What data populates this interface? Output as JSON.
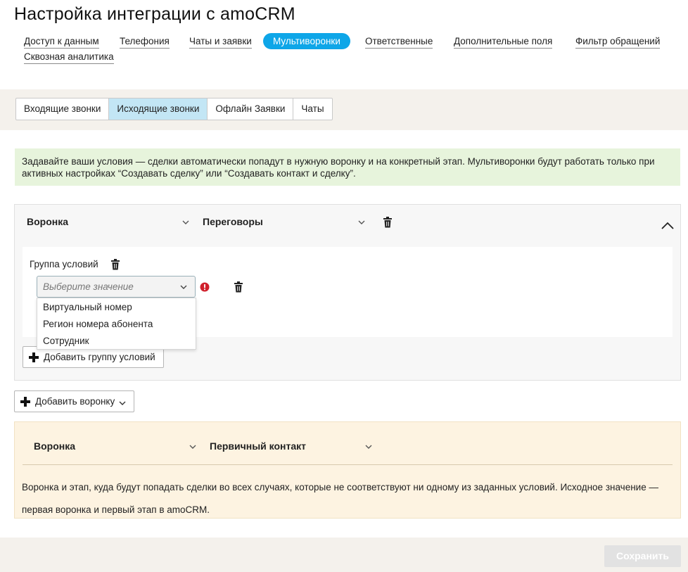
{
  "page_title": "Настройка интеграции с amoCRM",
  "nav": {
    "items": [
      "Доступ к данным",
      "Телефония",
      "Чаты и заявки",
      "Мультиворонки",
      "Ответственные",
      "Дополнительные поля",
      "Фильтр обращений",
      "Сквозная аналитика"
    ],
    "active_index": 3
  },
  "subtabs": {
    "items": [
      "Входящие звонки",
      "Исходящие звонки",
      "Офлайн Заявки",
      "Чаты"
    ],
    "active_index": 1
  },
  "info_text": "Задавайте ваши условия — сделки автоматически попадут в нужную воронку и на конкретный этап. Мультиворонки будут работать только при активных настройках “Создавать сделку” или “Создавать контакт и сделку”.",
  "funnel": {
    "funnel_value": "Воронка",
    "stage_value": "Переговоры",
    "group_label": "Группа условий",
    "condition_select": {
      "placeholder": "Выберите значение",
      "options": [
        "Виртуальный номер",
        "Регион номера абонента",
        "Сотрудник"
      ]
    },
    "add_group_label": "Добавить группу условий"
  },
  "add_funnel_label": "Добавить воронку",
  "default": {
    "funnel_value": "Воронка",
    "stage_value": "Первичный контакт",
    "description": "Воронка и этап, куда будут попадать сделки во всех случаях, которые не соответствуют ни одному из заданных условий. Исходное значение — первая воронка и первый этап в amoCRM."
  },
  "save_label": "Сохранить",
  "colors": {
    "accent": "#0ea6e8",
    "active_subtab": "#c3e6f5",
    "info_bg": "#e7f4dc",
    "default_bg": "#fdf3e1",
    "error": "#d0202c"
  },
  "icons": {
    "trash": "trash-icon",
    "chevron": "chevron-down-icon",
    "collapse": "chevron-up-icon",
    "error": "error-icon",
    "plus": "plus-icon"
  }
}
